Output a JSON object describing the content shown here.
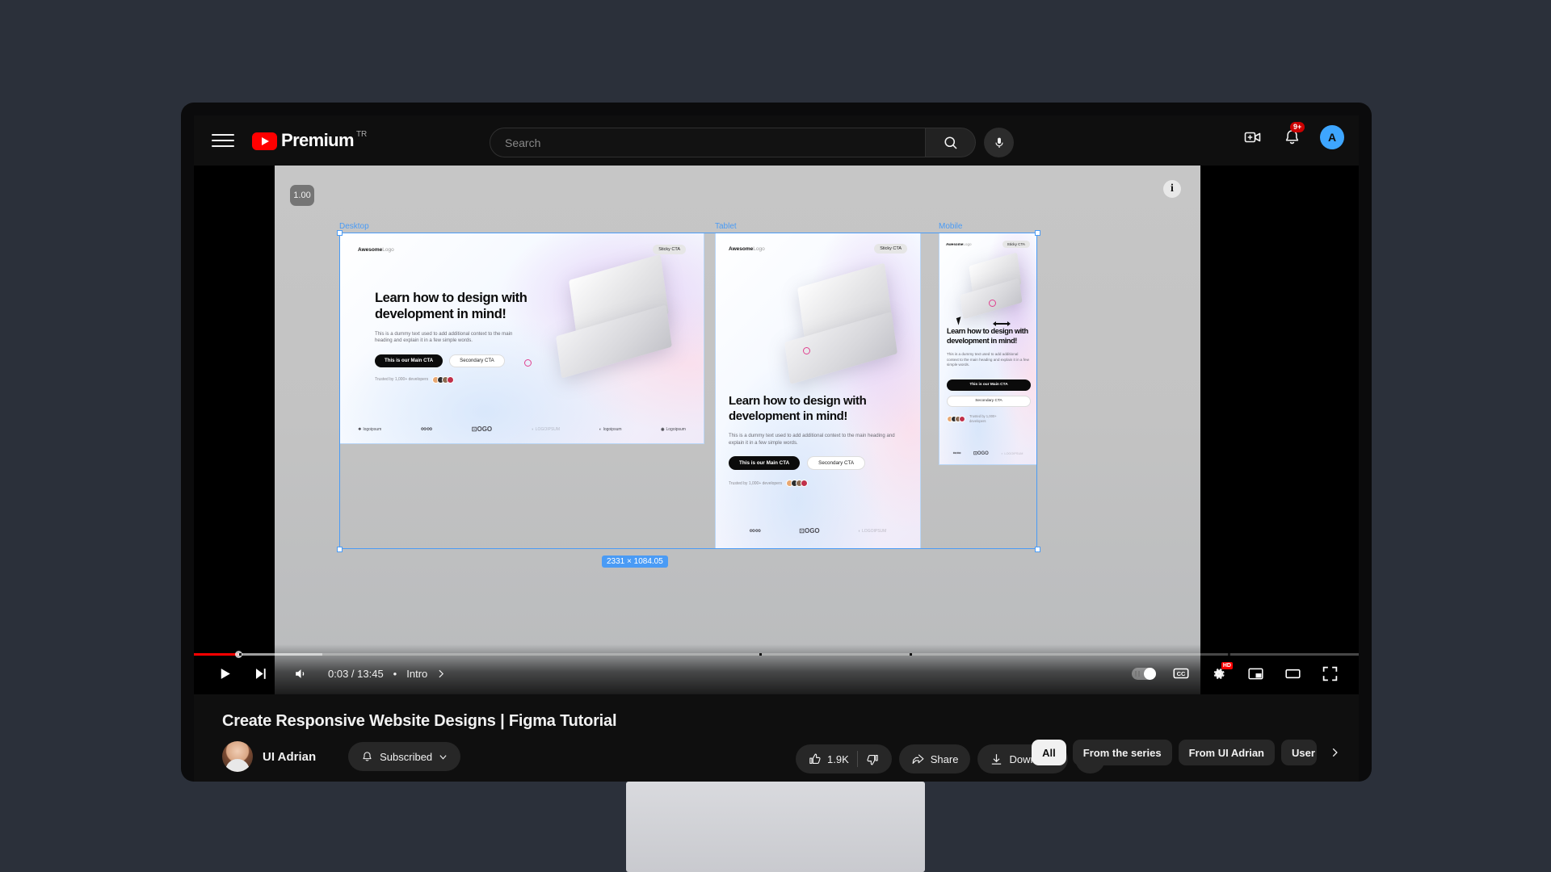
{
  "app": {
    "header": {
      "menu_icon": "hamburger-menu-icon",
      "logo_text": "Premium",
      "region_tag": "TR",
      "search_placeholder": "Search",
      "search_value": "",
      "search_icon": "search-icon",
      "mic_icon": "microphone-icon",
      "create_icon": "create-video-icon",
      "notifications_icon": "bell-icon",
      "notifications_badge": "9+",
      "avatar_initial": "A",
      "avatar_color": "#3ea6ff"
    },
    "player": {
      "play_icon": "play-icon",
      "next_icon": "next-video-icon",
      "volume_icon": "volume-icon",
      "time_display": "0:03 / 13:45",
      "time_separator": "•",
      "chapter_label": "Intro",
      "chapter_chevron": "chevron-right-icon",
      "autoplay_icon": "autoplay-toggle",
      "captions_icon": "closed-captions-icon",
      "settings_icon": "gear-icon",
      "settings_badge": "HD",
      "miniplayer_icon": "miniplayer-icon",
      "theater_icon": "theater-mode-icon",
      "fullscreen_icon": "fullscreen-icon",
      "progress_percent": 3.8,
      "buffered_percent": 11
    },
    "video_overlay": {
      "timestamp_badge": "1.00",
      "info_icon": "info-icon"
    },
    "video_info": {
      "title": "Create Responsive Website Designs | Figma Tutorial",
      "channel_name": "UI Adrian",
      "subscribe_label": "Subscribed",
      "subscribe_bell_icon": "bell-icon",
      "subscribe_chevron_icon": "chevron-down-icon",
      "like_count": "1.9K",
      "like_icon": "thumbs-up-icon",
      "dislike_icon": "thumbs-down-icon",
      "share_label": "Share",
      "share_icon": "share-icon",
      "download_label": "Download",
      "download_icon": "download-icon",
      "more_label": "...",
      "more_icon": "more-horizontal-icon"
    },
    "filter_chips": {
      "items": [
        {
          "label": "All",
          "active": true
        },
        {
          "label": "From the series",
          "active": false
        },
        {
          "label": "From UI Adrian",
          "active": false
        },
        {
          "label": "User",
          "active": false
        }
      ],
      "next_icon": "chevron-right-icon"
    }
  },
  "figma_canvas": {
    "selection_size_badge": "2331 × 1084.05",
    "selection_color": "#4a9bf5",
    "frames": [
      {
        "label": "Desktop",
        "nav_logo_bold": "Awesome",
        "nav_logo_light": "Logo",
        "sticky_cta": "Sticky CTA",
        "heading": "Learn how to design with development in mind!",
        "body": "This is a dummy text used to add additional context to the main heading and explain it in a few simple words.",
        "cta_primary": "This is our Main CTA",
        "cta_secondary": "Secondary CTA",
        "trust_text": "Trusted by 1,000+ developers"
      },
      {
        "label": "Tablet",
        "nav_logo_bold": "Awesome",
        "nav_logo_light": "Logo",
        "sticky_cta": "Sticky CTA",
        "heading": "Learn how to design with development in mind!",
        "body": "This is a dummy text used to add additional context to the main heading and explain it in a few simple words.",
        "cta_primary": "This is our Main CTA",
        "cta_secondary": "Secondary CTA",
        "trust_text": "Trusted by 1,000+ developers"
      },
      {
        "label": "Mobile",
        "nav_logo_bold": "Awesome",
        "nav_logo_light": "Logo",
        "sticky_cta": "Sticky CTA",
        "heading": "Learn how to design with development in mind!",
        "body": "This is a dummy text used to add additional context to the main heading and explain it in a few simple words.",
        "cta_primary": "This is our Main CTA",
        "cta_secondary": "Secondary CTA",
        "trust_text": "Trusted by 1,000+ developers"
      }
    ],
    "partner_logos": [
      "logoipsum",
      "logoipsum",
      "LOGO",
      "LOGOIPSUM",
      "logoipsum",
      "Logoipsum"
    ]
  }
}
